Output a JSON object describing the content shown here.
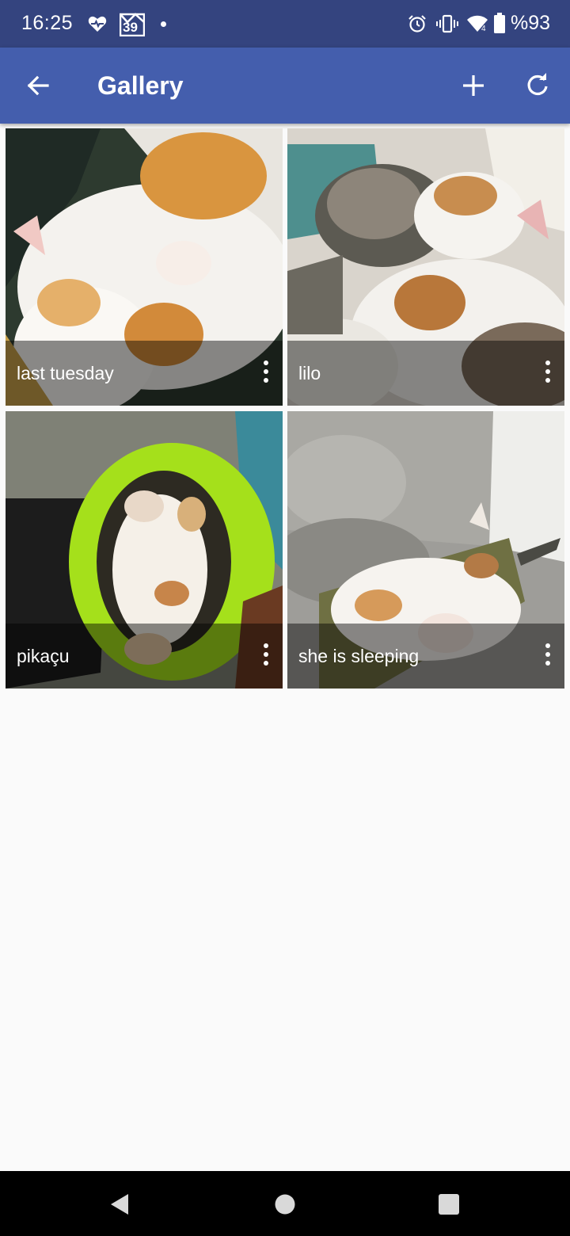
{
  "status_bar": {
    "time": "16:25",
    "calendar_day": "39",
    "battery": "%93",
    "icons": [
      "heart-monitor-icon",
      "calendar-icon",
      "alarm-icon",
      "vibrate-icon",
      "wifi-icon",
      "battery-icon"
    ]
  },
  "app_bar": {
    "title": "Gallery",
    "back_icon": "arrow-left-icon",
    "add_icon": "plus-icon",
    "refresh_icon": "refresh-icon"
  },
  "gallery": {
    "items": [
      {
        "caption": "last tuesday"
      },
      {
        "caption": "lilo"
      },
      {
        "caption": "pikaçu"
      },
      {
        "caption": "she is sleeping"
      }
    ]
  },
  "nav_bar": {
    "icons": [
      "back-triangle-icon",
      "home-circle-icon",
      "recents-square-icon"
    ]
  },
  "colors": {
    "status_bar": "#34447f",
    "app_bar": "#445ead",
    "background": "#fafafa"
  }
}
